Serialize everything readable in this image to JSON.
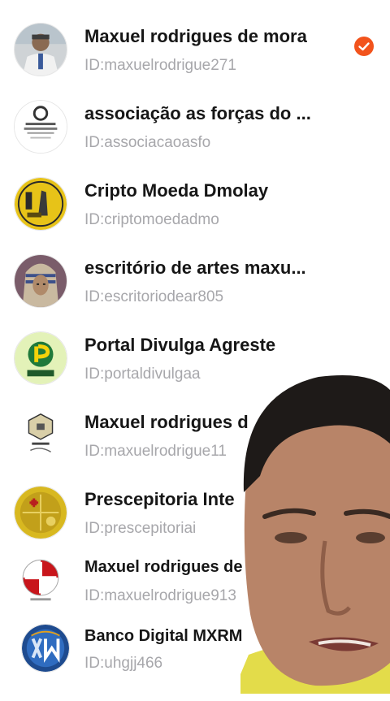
{
  "colors": {
    "accent": "#f2531c",
    "name_text": "#161616",
    "id_text": "#a7a7ab"
  },
  "accounts": [
    {
      "name": "Maxuel rodrigues de mora",
      "id": "ID:maxuelrodrigue271",
      "avatar": "profile-photo-icon",
      "selected": true
    },
    {
      "name": "associação as forças do ...",
      "id": "ID:associacaoasfo",
      "avatar": "association-logo-icon",
      "selected": false
    },
    {
      "name": "Cripto Moeda Dmolay",
      "id": "ID:criptomoedadmo",
      "avatar": "gold-coin-logo-icon",
      "selected": false
    },
    {
      "name": "escritório de artes maxu...",
      "id": "ID:escritoriodear805",
      "avatar": "pharaoh-art-icon",
      "selected": false
    },
    {
      "name": "Portal Divulga Agreste",
      "id": "ID:portaldivulgaa",
      "avatar": "portal-logo-icon",
      "selected": false
    },
    {
      "name": "Maxuel rodrigues d",
      "id": "ID:maxuelrodrigue11",
      "avatar": "mxrm-emblem-icon",
      "selected": false
    },
    {
      "name": "Prescepitoria Inte",
      "id": "ID:prescepitoriai",
      "avatar": "gold-cross-orb-icon",
      "selected": false
    },
    {
      "name": "Maxuel rodrigues de",
      "id": "ID:maxuelrodrigue913",
      "avatar": "red-cross-shield-icon",
      "selected": false
    },
    {
      "name": "Banco Digital MXRM",
      "id": "ID:uhgjj466",
      "avatar": "mx-bank-logo-icon",
      "selected": false
    }
  ],
  "selected_badge": "check-circle-icon",
  "overlay": "presenter-video-overlay"
}
